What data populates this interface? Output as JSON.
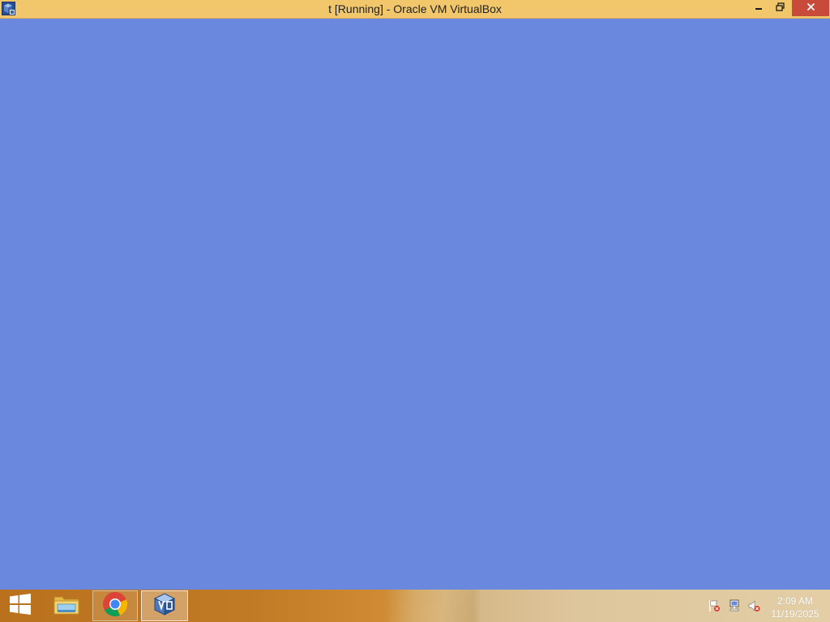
{
  "window": {
    "title": "t [Running] - Oracle VM VirtualBox",
    "app_icon": "virtualbox-icon",
    "controls": {
      "minimize_icon": "minimize-icon",
      "maximize_icon": "restore-icon",
      "close_icon": "close-icon"
    }
  },
  "vm": {
    "display_color": "#6a89de"
  },
  "taskbar": {
    "start_icon": "windows-logo-icon",
    "pinned": [
      {
        "name": "file-explorer",
        "icon": "folder-icon"
      },
      {
        "name": "google-chrome",
        "icon": "chrome-icon"
      },
      {
        "name": "virtualbox",
        "icon": "virtualbox-icon",
        "active": true
      }
    ],
    "tray": {
      "icons": [
        "action-center-flag-icon",
        "network-icon",
        "volume-muted-icon"
      ],
      "time": "2:09 AM",
      "date": "11/19/2025"
    }
  },
  "colors": {
    "titlebar": "#f2c66b",
    "close_button": "#c74a3a",
    "desktop": "#6a89de",
    "taskbar": "#c07a25"
  }
}
